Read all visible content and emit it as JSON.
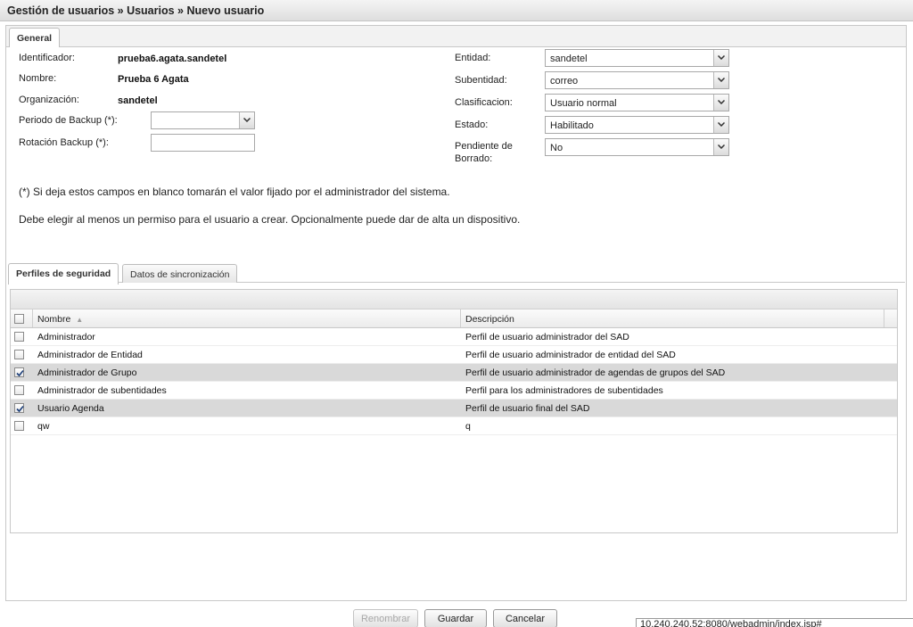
{
  "title": "Gestión de usuarios » Usuarios » Nuevo usuario",
  "tabs": {
    "general": "General"
  },
  "left_fields": {
    "identificador": {
      "label": "Identificador:",
      "value": "prueba6.agata.sandetel"
    },
    "nombre": {
      "label": "Nombre:",
      "value": "Prueba 6 Agata"
    },
    "organizacion": {
      "label": "Organización:",
      "value": "sandetel"
    },
    "periodo_backup": {
      "label": "Periodo de Backup (*):",
      "value": ""
    },
    "rotacion_backup": {
      "label": "Rotación Backup (*):",
      "value": ""
    }
  },
  "right_fields": {
    "entidad": {
      "label": "Entidad:",
      "value": "sandetel"
    },
    "subentidad": {
      "label": "Subentidad:",
      "value": "correo"
    },
    "clasificacion": {
      "label": "Clasificacion:",
      "value": "Usuario normal"
    },
    "estado": {
      "label": "Estado:",
      "value": "Habilitado"
    },
    "pendiente_borrado": {
      "label_line1": "Pendiente de",
      "label_line2": "Borrado:",
      "value": "No"
    }
  },
  "notes": {
    "blank_fields": "(*) Si deja estos campos en blanco tomarán el valor fijado por el administrador del sistema.",
    "permission_required": "Debe elegir al menos un permiso para el usuario a crear. Opcionalmente puede dar de alta un dispositivo."
  },
  "sub_tabs": {
    "perfiles": "Perfiles de seguridad",
    "datos": "Datos de sincronización"
  },
  "grid": {
    "columns": {
      "nombre": "Nombre",
      "descripcion": "Descripción"
    },
    "sort_indicator": "▲",
    "rows": [
      {
        "nombre": "Administrador",
        "descripcion": "Perfil de usuario administrador del SAD",
        "checked": false
      },
      {
        "nombre": "Administrador de Entidad",
        "descripcion": "Perfil de usuario administrador de entidad del SAD",
        "checked": false
      },
      {
        "nombre": "Administrador de Grupo",
        "descripcion": "Perfil de usuario administrador de agendas de grupos del SAD",
        "checked": true
      },
      {
        "nombre": "Administrador de subentidades",
        "descripcion": "Perfil para los administradores de subentidades",
        "checked": false
      },
      {
        "nombre": "Usuario Agenda",
        "descripcion": "Perfil de usuario final del SAD",
        "checked": true
      },
      {
        "nombre": "qw",
        "descripcion": "q",
        "checked": false
      }
    ]
  },
  "buttons": {
    "renombrar": "Renombrar",
    "guardar": "Guardar",
    "cancelar": "Cancelar"
  },
  "status_url": "10.240.240.52:8080/webadmin/index.jsp#",
  "icons": {
    "dropdown": "chevron-down-icon",
    "check": "check-icon"
  }
}
